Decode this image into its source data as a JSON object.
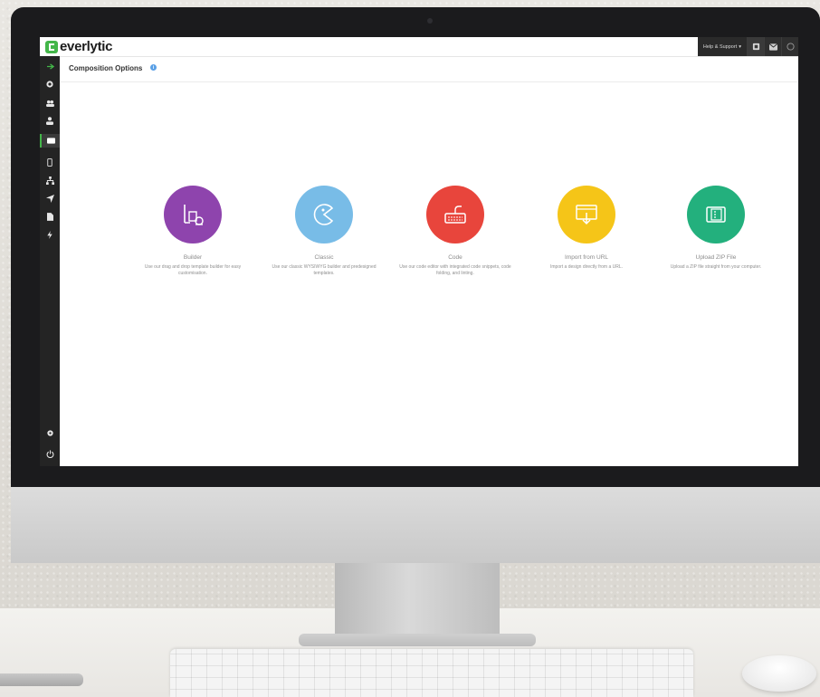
{
  "topbar": {
    "logo_text": "everlytic",
    "help_label": "Help & Support",
    "help_caret": "▾"
  },
  "page": {
    "title": "Composition Options",
    "info_glyph": "i"
  },
  "options": [
    {
      "title": "Builder",
      "description": "Use our drag and drop template builder for easy customisation.",
      "color": "#8e44ad",
      "icon": "builder-icon"
    },
    {
      "title": "Classic",
      "description": "Use our classic WYSIWYG builder and predesigned templates.",
      "color": "#78bce7",
      "icon": "classic-icon"
    },
    {
      "title": "Code",
      "description": "Use our code editor with integrated code snippets, code folding, and linting.",
      "color": "#e8453c",
      "icon": "code-icon"
    },
    {
      "title": "Import from URL",
      "description": "Import a design directly from a URL.",
      "color": "#f5c518",
      "icon": "import-url-icon"
    },
    {
      "title": "Upload ZIP File",
      "description": "Upload a ZIP file straight from your computer.",
      "color": "#23b07d",
      "icon": "upload-zip-icon"
    }
  ],
  "colors": {
    "brand_green": "#43b649",
    "sidebar_bg": "#242424",
    "topbar_dark": "#2a2a2a"
  }
}
